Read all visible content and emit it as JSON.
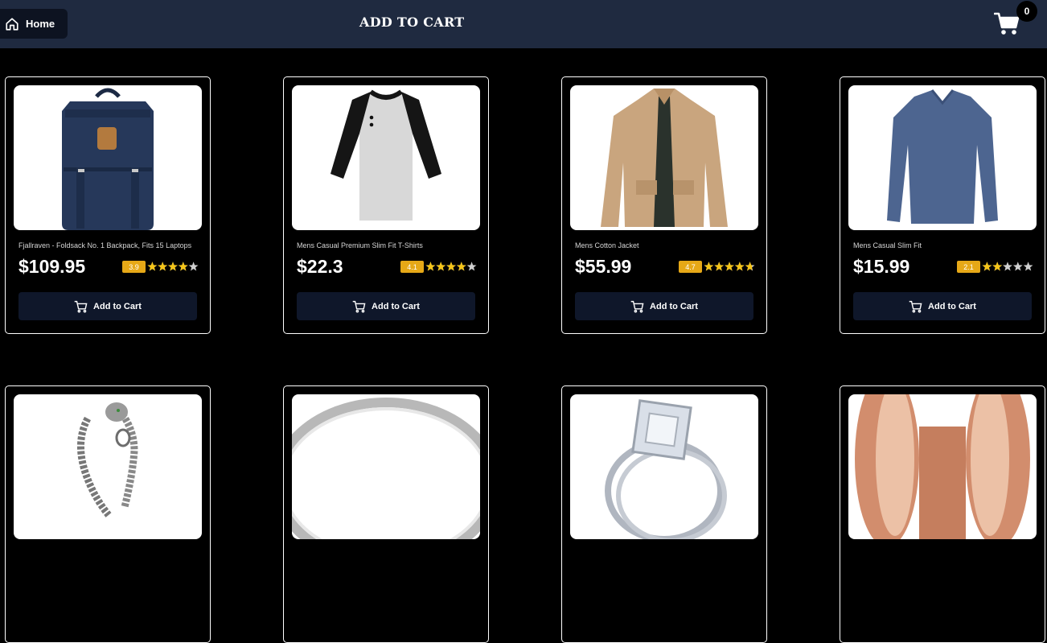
{
  "navbar": {
    "home_label": "Home",
    "brand": "ADD TO CART",
    "cart_count": "0"
  },
  "colors": {
    "navbar_bg": "#1f2a40",
    "button_bg": "#0f172a",
    "rating_badge": "#e6a817",
    "star_filled": "#f5c518",
    "star_empty": "#d0d0d0"
  },
  "products": [
    {
      "title": "Fjallraven - Foldsack No. 1 Backpack, Fits 15 Laptops",
      "price": "$109.95",
      "rating": "3.9",
      "stars": 3.9,
      "button": "Add to Cart",
      "image": "navy-backpack"
    },
    {
      "title": "Mens Casual Premium Slim Fit T-Shirts",
      "price": "$22.3",
      "rating": "4.1",
      "stars": 4.1,
      "button": "Add to Cart",
      "image": "raglan-henley-tshirt"
    },
    {
      "title": "Mens Cotton Jacket",
      "price": "$55.99",
      "rating": "4.7",
      "stars": 4.7,
      "button": "Add to Cart",
      "image": "beige-cotton-jacket"
    },
    {
      "title": "Mens Casual Slim Fit",
      "price": "$15.99",
      "rating": "2.1",
      "stars": 2.1,
      "button": "Add to Cart",
      "image": "blue-long-sleeve-shirt"
    },
    {
      "image": "dragon-chain-bracelet"
    },
    {
      "image": "silver-band-ring"
    },
    {
      "image": "diamond-engagement-ring"
    },
    {
      "image": "rose-gold-plugs"
    }
  ]
}
